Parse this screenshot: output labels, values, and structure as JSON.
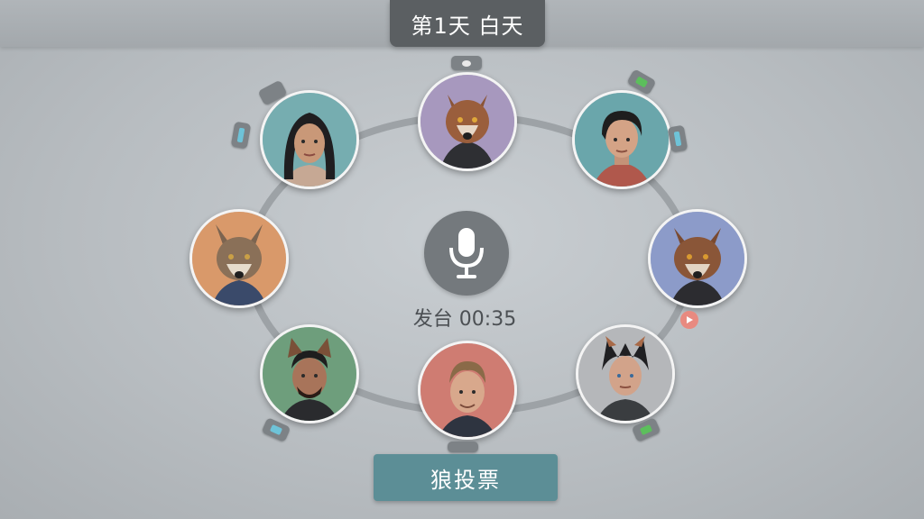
{
  "header": {
    "phase_label": "第1天 白天"
  },
  "center": {
    "mic_icon": "microphone-icon",
    "speak_status": "发台 00:35"
  },
  "actions": {
    "vote_label": "狼投票"
  },
  "players": [
    {
      "id": "top",
      "kind": "wolf",
      "bg": "#a798be"
    },
    {
      "id": "top-right",
      "kind": "human",
      "bg": "#6aa6ab"
    },
    {
      "id": "right",
      "kind": "wolf",
      "bg": "#8c9bc9"
    },
    {
      "id": "bottom-right",
      "kind": "human-wolf-ears",
      "bg": "#b5b7ba"
    },
    {
      "id": "bottom",
      "kind": "human",
      "bg": "#cf7c72"
    },
    {
      "id": "bottom-left",
      "kind": "human-wolf-ears",
      "bg": "#6e9e7c"
    },
    {
      "id": "left",
      "kind": "wolf",
      "bg": "#d9996a"
    },
    {
      "id": "top-left",
      "kind": "human",
      "bg": "#76adb0"
    }
  ],
  "colors": {
    "banner_bg": "#5b5f62",
    "vote_button": "#5c8e96",
    "status_green": "#5cbf5c",
    "status_blue": "#6ec3d8",
    "speaking_arrow": "#e88a80"
  }
}
